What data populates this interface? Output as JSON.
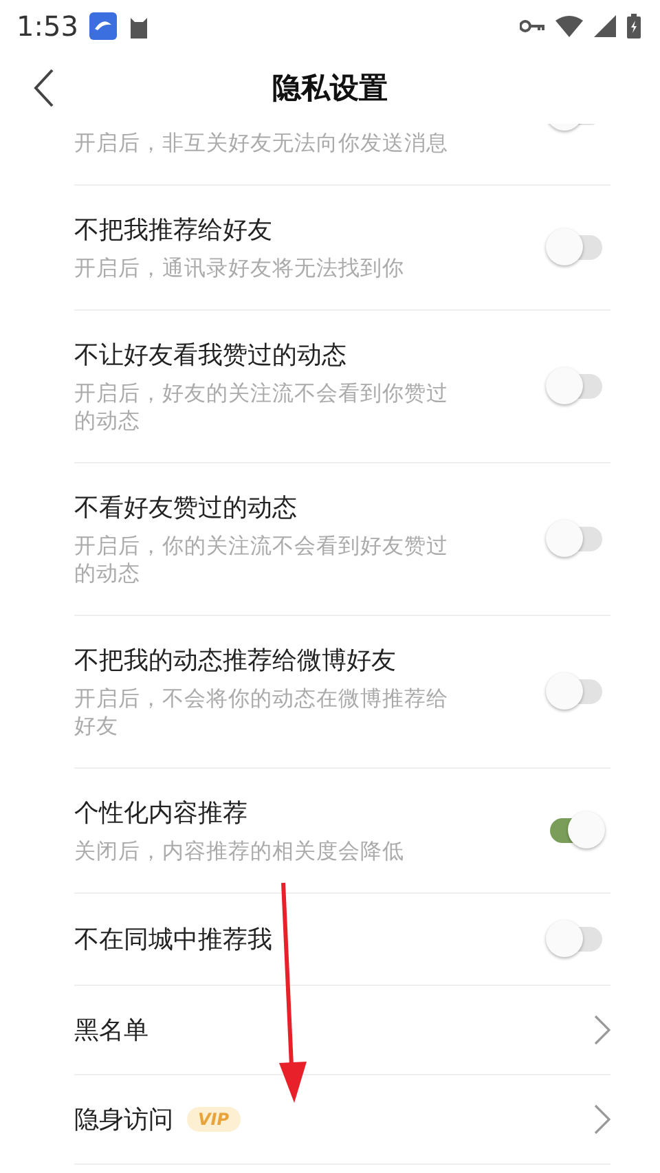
{
  "status_bar": {
    "time": "1:53"
  },
  "header": {
    "title": "隐私设置"
  },
  "rows": [
    {
      "kind": "toggle",
      "subtitle": "开启后，非互关好友无法向你发送消息",
      "on": false
    },
    {
      "kind": "toggle",
      "title": "不把我推荐给好友",
      "subtitle": "开启后，通讯录好友将无法找到你",
      "on": false
    },
    {
      "kind": "toggle",
      "title": "不让好友看我赞过的动态",
      "subtitle": "开启后，好友的关注流不会看到你赞过的动态",
      "on": false
    },
    {
      "kind": "toggle",
      "title": "不看好友赞过的动态",
      "subtitle": "开启后，你的关注流不会看到好友赞过的动态",
      "on": false
    },
    {
      "kind": "toggle",
      "title": "不把我的动态推荐给微博好友",
      "subtitle": "开启后，不会将你的动态在微博推荐给好友",
      "on": false
    },
    {
      "kind": "toggle",
      "title": "个性化内容推荐",
      "subtitle": "关闭后，内容推荐的相关度会降低",
      "on": true
    },
    {
      "kind": "toggle",
      "title": "不在同城中推荐我",
      "on": false
    },
    {
      "kind": "link",
      "title": "黑名单"
    },
    {
      "kind": "link",
      "title": "隐身访问",
      "badge": "VIP"
    }
  ]
}
